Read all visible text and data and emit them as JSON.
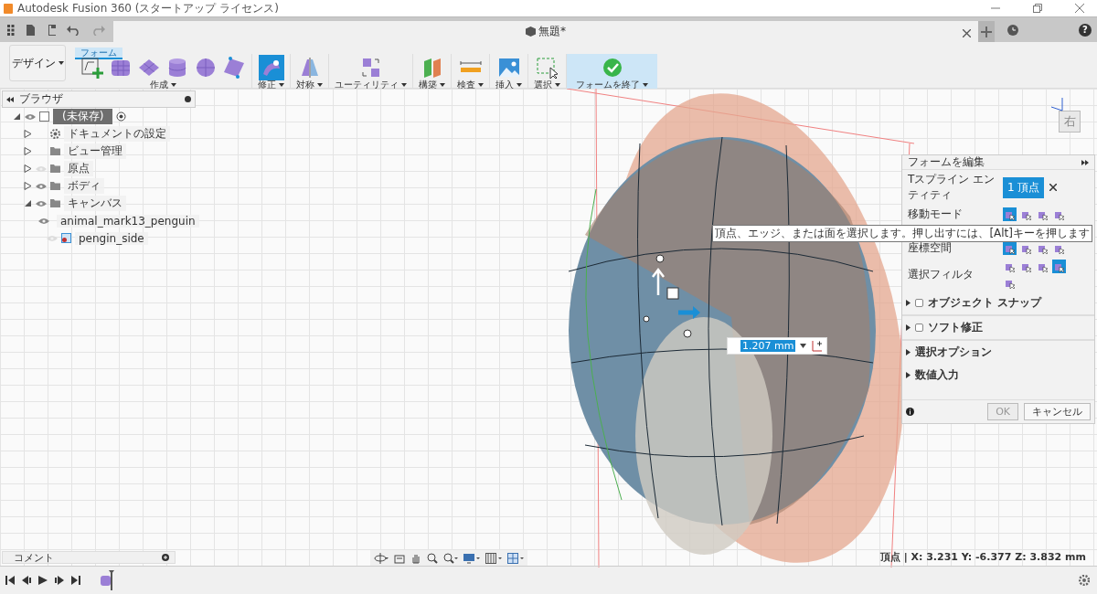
{
  "window": {
    "title": "Autodesk Fusion 360 (スタートアップ ライセンス)"
  },
  "document_tab": {
    "title": "無題*"
  },
  "help_button": {
    "label": "?"
  },
  "workspace": {
    "label": "デザイン"
  },
  "toolbar_tab": {
    "label": "フォーム",
    "selected": true
  },
  "toolbar_groups": [
    {
      "label": "作成",
      "tools": [
        {
          "kind": "sketch"
        },
        {
          "kind": "box"
        },
        {
          "kind": "plane"
        },
        {
          "kind": "cylinder"
        },
        {
          "kind": "sphere"
        },
        {
          "kind": "quadball"
        }
      ],
      "highlighted": false,
      "kind": "tool"
    },
    {
      "label": "修正",
      "tools": [
        {
          "kind": "edit-form"
        }
      ],
      "highlighted": true,
      "kind": "tool"
    },
    {
      "label": "対称",
      "tools": [
        {
          "kind": "mirror"
        }
      ],
      "highlighted": false,
      "kind": "tool"
    },
    {
      "label": "ユーティリティ",
      "tools": [
        {
          "kind": "utility"
        }
      ],
      "highlighted": false,
      "kind": "tool"
    },
    {
      "label": "構築",
      "tools": [
        {
          "kind": "construct"
        }
      ],
      "highlighted": false,
      "kind": "tool"
    },
    {
      "label": "検査",
      "tools": [
        {
          "kind": "measure"
        }
      ],
      "highlighted": false,
      "kind": "tool"
    },
    {
      "label": "挿入",
      "tools": [
        {
          "kind": "image"
        }
      ],
      "highlighted": false,
      "kind": "tool"
    },
    {
      "label": "選択",
      "tools": [
        {
          "kind": "select"
        }
      ],
      "highlighted": false,
      "kind": "tool"
    },
    {
      "label": "フォームを終了",
      "tools": [
        {
          "kind": "finish"
        }
      ],
      "highlighted": true,
      "kind": "finish"
    }
  ],
  "browser": {
    "title": "ブラウザ",
    "tree": [
      {
        "label": "(未保存)",
        "kind": "root",
        "visible": true,
        "selected": true,
        "expanded": true,
        "children": [
          {
            "label": "ドキュメントの設定",
            "kind": "settings",
            "selected": false,
            "expanded": false
          },
          {
            "label": "ビュー管理",
            "kind": "folder",
            "selected": false,
            "expanded": false
          },
          {
            "label": "原点",
            "kind": "folder",
            "visible": false,
            "selected": false,
            "expanded": false
          },
          {
            "label": "ボディ",
            "kind": "folder",
            "visible": true,
            "selected": false,
            "expanded": false
          },
          {
            "label": "キャンバス",
            "kind": "folder",
            "visible": true,
            "selected": false,
            "expanded": true,
            "children": [
              {
                "label": "animal_mark13_penguin",
                "kind": "image",
                "visible": true,
                "selected": false
              },
              {
                "label": "pengin_side",
                "kind": "image",
                "visible": false,
                "selected": false
              }
            ]
          }
        ]
      }
    ]
  },
  "view_cube": {
    "face_label": "右"
  },
  "dimension_input": {
    "value": "1.207 mm"
  },
  "tooltip": {
    "text": "頂点、エッジ、または面を選択します。押し出すには、[Alt]キーを押します"
  },
  "form_panel": {
    "title": "フォームを編集",
    "entity": {
      "label": "Tスプライン エンティティ",
      "chip": "1 頂点"
    },
    "icon_rows": [
      {
        "label": "移動モード",
        "options": [
          {
            "selected": true
          },
          {
            "selected": false
          },
          {
            "selected": false
          },
          {
            "selected": false
          }
        ]
      },
      {
        "label": "座標空間",
        "options": [
          {
            "selected": true
          },
          {
            "selected": false
          },
          {
            "selected": false
          },
          {
            "selected": false
          }
        ]
      },
      {
        "label": "選択フィルタ",
        "options": [
          {
            "selected": false
          },
          {
            "selected": false
          },
          {
            "selected": false
          },
          {
            "selected": true
          },
          {
            "selected": false
          }
        ]
      }
    ],
    "sections": [
      {
        "label": "オブジェクト スナップ",
        "kind": "checkbox",
        "checked": false
      },
      {
        "label": "ソフト修正",
        "kind": "checkbox",
        "checked": false
      },
      {
        "label": "選択オプション",
        "kind": "plain"
      },
      {
        "label": "数値入力",
        "kind": "plain"
      }
    ],
    "buttons": [
      {
        "label": "OK",
        "disabled": true
      },
      {
        "label": "キャンセル",
        "disabled": false
      }
    ]
  },
  "comments": {
    "title": "コメント"
  },
  "status": {
    "text": "頂点 | X: 3.231 Y: -6.377 Z: 3.832 mm"
  }
}
